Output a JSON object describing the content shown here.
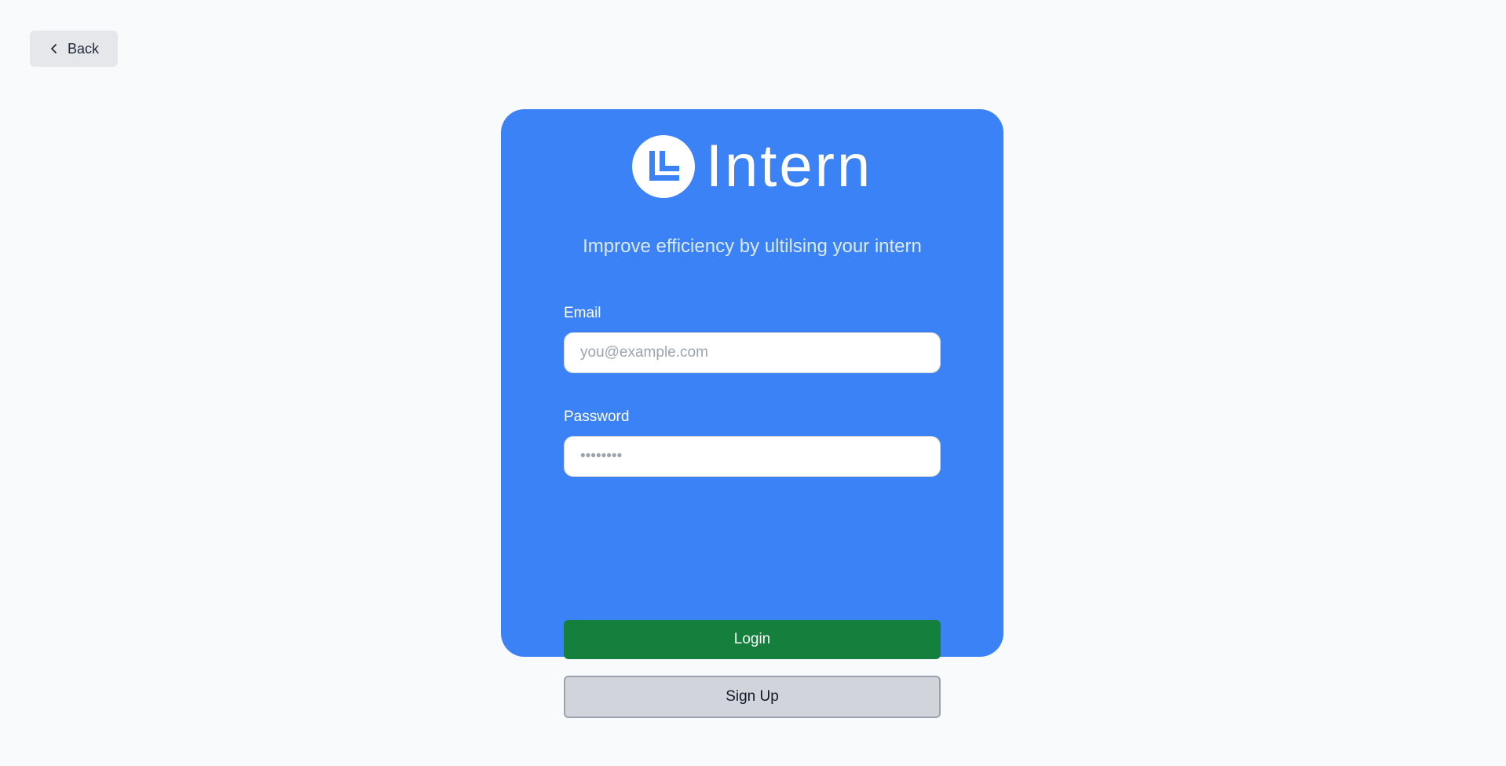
{
  "back_button": {
    "label": "Back",
    "icon": "chevron-left-icon"
  },
  "brand": {
    "name": "Intern",
    "logo_icon": "intern-logo-icon",
    "tagline": "Improve efficiency by ultilsing your intern"
  },
  "form": {
    "email": {
      "label": "Email",
      "value": "",
      "placeholder": "you@example.com"
    },
    "password": {
      "label": "Password",
      "value": "",
      "placeholder": "••••••••"
    },
    "login_label": "Login",
    "signup_label": "Sign Up"
  },
  "colors": {
    "page_background": "#f8fafc",
    "card_background": "#3b82f6",
    "login_button": "#15803d",
    "signup_button": "#d1d5db",
    "back_button": "#e5e7eb"
  }
}
